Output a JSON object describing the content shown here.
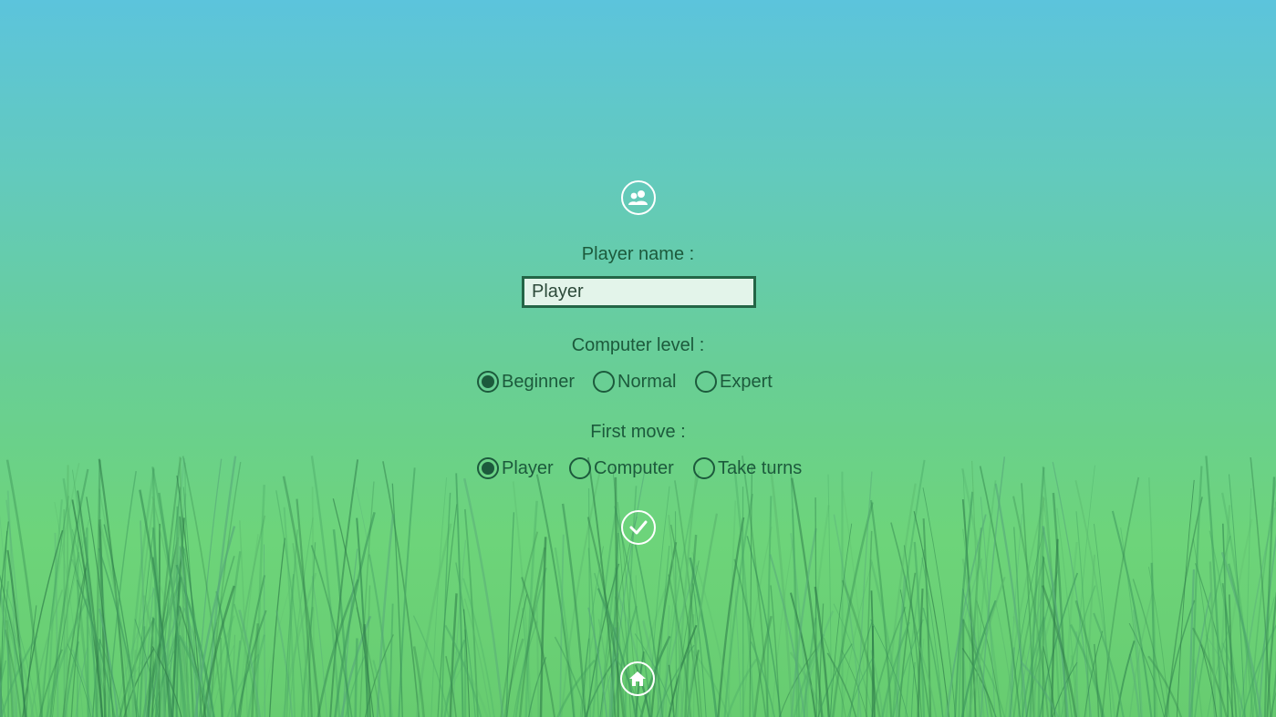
{
  "icons": {
    "players": "users-icon",
    "confirm": "checkmark-icon",
    "home": "home-icon"
  },
  "colors": {
    "sky_top": "#5cc4dc",
    "grass_bottom": "#67cc70",
    "text": "#1c5a3c",
    "input_border": "#236546",
    "input_bg": "#e3f4ea",
    "icon_stroke": "#ffffff"
  },
  "player_name": {
    "label": "Player name :",
    "value": "Player"
  },
  "computer_level": {
    "label": "Computer level :",
    "options": [
      "Beginner",
      "Normal",
      "Expert"
    ],
    "selected": "Beginner"
  },
  "first_move": {
    "label": "First move :",
    "options": [
      "Player",
      "Computer",
      "Take turns"
    ],
    "selected": "Player"
  }
}
